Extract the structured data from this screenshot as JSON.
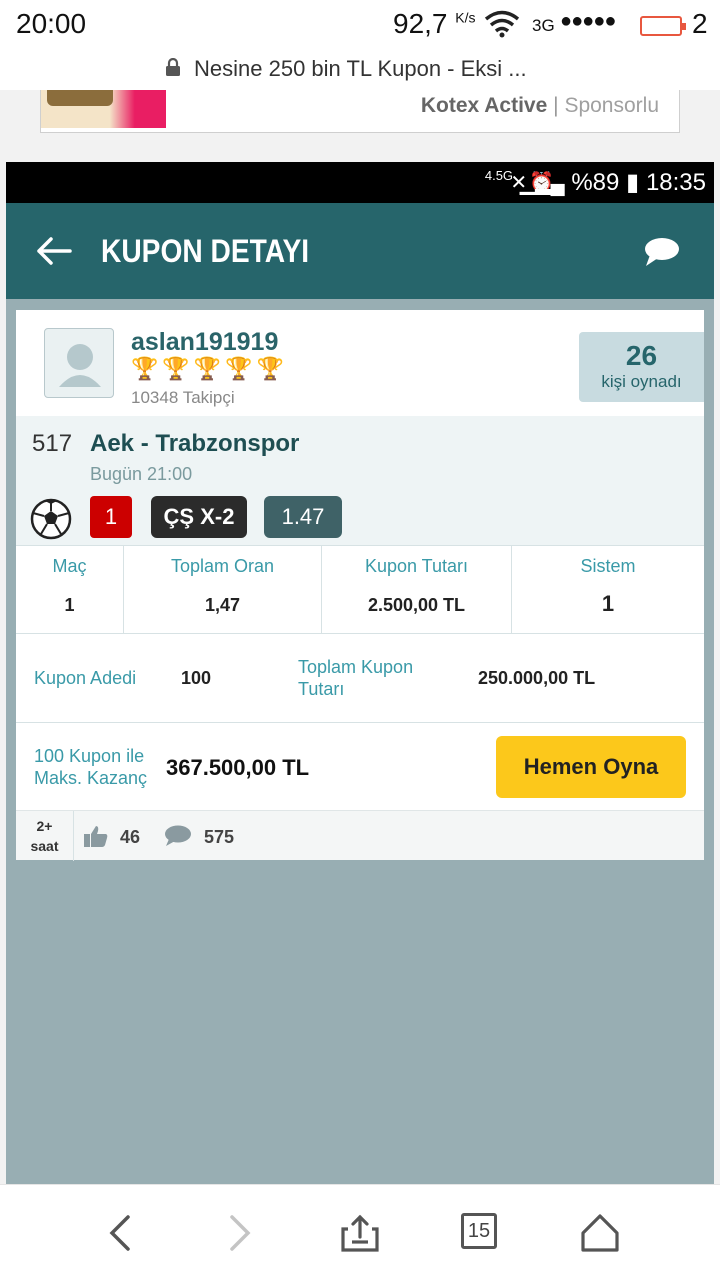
{
  "os_status": {
    "time": "20:00",
    "speed": "92,7",
    "speed_unit": "K/s",
    "network": "3G",
    "signal_dots": "●●●●●",
    "battery_level": "2"
  },
  "browser": {
    "page_title": "Nesine 250 bin TL Kupon - Eksi ...",
    "tab_count": "15"
  },
  "ad": {
    "brand": "Kotex Active",
    "separator": "|",
    "sponsored_label": "Sponsorlu"
  },
  "inner_status": {
    "network": "4.5G",
    "battery": "%89",
    "time": "18:35"
  },
  "header": {
    "title": "KUPON DETAYI"
  },
  "user": {
    "name": "aslan191919",
    "trophy_count": 5,
    "followers": "10348 Takipçi",
    "played_count": "26",
    "played_label": "kişi oynadı"
  },
  "match": {
    "code": "517",
    "teams": "Aek - Trabzonspor",
    "time": "Bugün 21:00",
    "pick": "1",
    "market": "ÇŞ X-2",
    "odds": "1.47"
  },
  "stats": [
    {
      "label": "Maç",
      "value": "1"
    },
    {
      "label": "Toplam Oran",
      "value": "1,47"
    },
    {
      "label": "Kupon Tutarı",
      "value": "2.500,00 TL"
    },
    {
      "label": "Sistem",
      "value": "1"
    }
  ],
  "coupon": {
    "count_label": "Kupon Adedi",
    "count_value": "100",
    "total_label": "Toplam Kupon Tutarı",
    "total_value": "250.000,00 TL",
    "max_win_label": "100 Kupon ile Maks. Kazanç",
    "max_win_value": "367.500,00 TL",
    "play_button": "Hemen Oyna"
  },
  "footer": {
    "age_line1": "2+",
    "age_line2": "saat",
    "likes": "46",
    "comments": "575"
  }
}
